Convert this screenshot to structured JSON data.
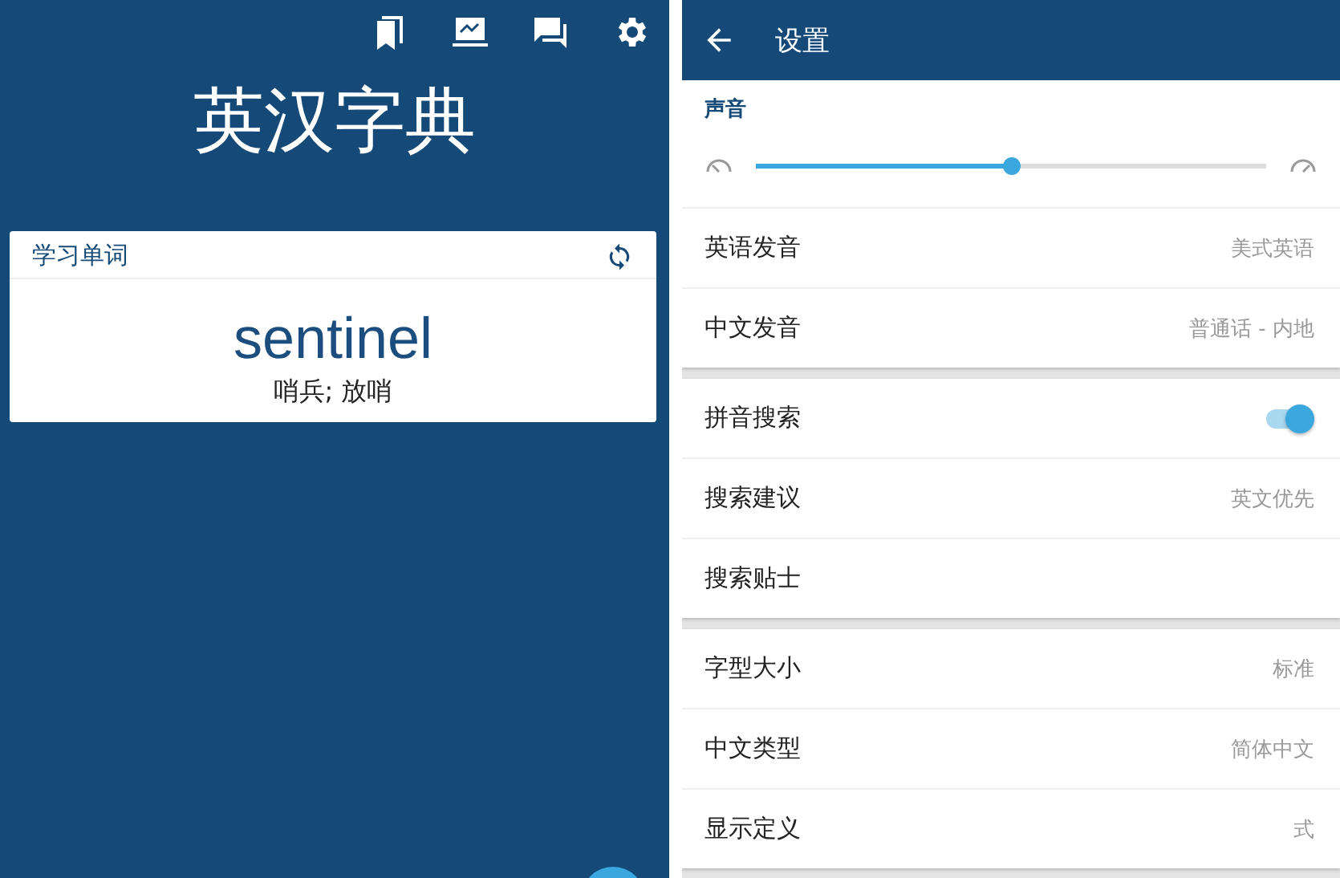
{
  "home": {
    "title": "英汉字典",
    "card": {
      "heading": "学习单词",
      "word": "sentinel",
      "translation": "哨兵; 放哨"
    }
  },
  "settings": {
    "title": "设置",
    "sections": [
      {
        "heading": "声音",
        "rows": [
          {
            "kind": "slider",
            "level": 0.5
          },
          {
            "kind": "value",
            "label": "英语发音",
            "value": "美式英语"
          },
          {
            "kind": "value",
            "label": "中文发音",
            "value": "普通话 - 内地"
          }
        ]
      },
      {
        "rows": [
          {
            "kind": "toggle",
            "label": "拼音搜索",
            "on": true
          },
          {
            "kind": "value",
            "label": "搜索建议",
            "value": "英文优先"
          },
          {
            "kind": "value",
            "label": "搜索贴士"
          }
        ]
      },
      {
        "rows": [
          {
            "kind": "value",
            "label": "字型大小",
            "value": "标准"
          },
          {
            "kind": "value",
            "label": "中文类型",
            "value": "简体中文"
          },
          {
            "kind": "value",
            "label": "显示定义",
            "value": "式"
          }
        ]
      }
    ]
  }
}
